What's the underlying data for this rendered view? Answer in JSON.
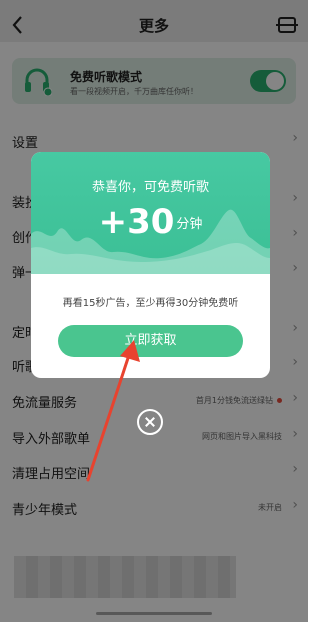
{
  "header": {
    "title": "更多",
    "back_icon": "chevron-left-icon",
    "right_icon": "scan-icon"
  },
  "free_mode": {
    "title": "免费听歌模式",
    "subtitle": "看一段视频开启，千万曲库任你听！",
    "enabled": true
  },
  "menu": {
    "settings": "设置",
    "row2": "装扮",
    "row3": "创作",
    "row4": "弹一",
    "row5": "定时",
    "row6": "听歌",
    "data_saver": {
      "label": "免流量服务",
      "hint": "首月1分钱免流送绿钻"
    },
    "import": {
      "label": "导入外部歌单",
      "hint": "网页和图片导入黑科技"
    },
    "clear": {
      "label": "清理占用空间"
    },
    "youth": {
      "label": "青少年模式",
      "hint": "未开启"
    }
  },
  "modal": {
    "title": "恭喜你，可免费听歌",
    "bonus_value": "+30",
    "bonus_unit": "分钟",
    "description": "再看15秒广告，至少再得30分钟免费听",
    "button_label": "立即获取"
  },
  "colors": {
    "accent": "#4ac58f",
    "modal_header": "#47c9a2",
    "arrow": "#e8432f"
  }
}
